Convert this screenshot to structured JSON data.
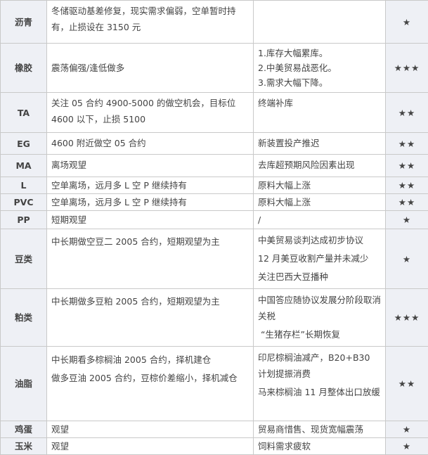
{
  "rows": [
    {
      "name": "沥青",
      "strategy": [
        "冬储驱动基差修复，现实需求偏弱，空单暂时持有，止损设在 3150 元"
      ],
      "reasons": [],
      "rating": "★"
    },
    {
      "name": "橡胶",
      "strategy": [
        "震荡偏强/逢低做多"
      ],
      "reasons": [
        "1.库存大幅累库。",
        "2.中美贸易战恶化。",
        "3.需求大幅下降。"
      ],
      "rating": "★★★"
    },
    {
      "name": "TA",
      "strategy": [
        "关注 05 合约 4900-5000 的做空机会，目标位 4600 以下，止损 5100"
      ],
      "reasons": [
        "终端补库"
      ],
      "rating": "★★"
    },
    {
      "name": "EG",
      "strategy": [
        "4600 附近做空 05 合约"
      ],
      "reasons": [
        "新装置投产推迟"
      ],
      "rating": "★★"
    },
    {
      "name": "MA",
      "strategy": [
        "离场观望"
      ],
      "reasons": [
        "去库超预期风险因素出现"
      ],
      "rating": "★★"
    },
    {
      "name": "L",
      "strategy": [
        "空单离场，远月多 L 空 P 继续持有"
      ],
      "reasons": [
        "原料大幅上涨"
      ],
      "rating": "★★"
    },
    {
      "name": "PVC",
      "strategy": [
        "空单离场，远月多 L 空 P 继续持有"
      ],
      "reasons": [
        "原料大幅上涨"
      ],
      "rating": "★★"
    },
    {
      "name": "PP",
      "strategy": [
        "短期观望"
      ],
      "reasons": [
        "/"
      ],
      "rating": "★"
    },
    {
      "name": "豆类",
      "strategy": [
        "中长期做空豆二 2005 合约，短期观望为主"
      ],
      "reasons": [
        "中美贸易谈判达成初步协议",
        "12 月美豆收割产量并未减少",
        "关注巴西大豆播种"
      ],
      "rating": "★"
    },
    {
      "name": "粕类",
      "strategy": [
        "中长期做多豆粕 2005 合约，短期观望为主"
      ],
      "reasons": [
        "中国答应随协议发展分阶段取消关税",
        "“生猪存栏”长期恢复"
      ],
      "rating": "★★★"
    },
    {
      "name": "油脂",
      "strategy": [
        "中长期看多棕榈油 2005 合约，择机建仓",
        "做多豆油 2005 合约，豆棕价差缩小，择机减仓"
      ],
      "reasons": [
        "印尼棕榈油减产，B20+B30 计划提振消费",
        "马来棕榈油 11 月整体出口放缓"
      ],
      "rating": "★★"
    },
    {
      "name": "鸡蛋",
      "strategy": [
        "观望"
      ],
      "reasons": [
        "贸易商惜售、现货宽幅震荡"
      ],
      "rating": "★"
    },
    {
      "name": "玉米",
      "strategy": [
        "观望"
      ],
      "reasons": [
        "饲料需求疲软"
      ],
      "rating": "★"
    }
  ]
}
